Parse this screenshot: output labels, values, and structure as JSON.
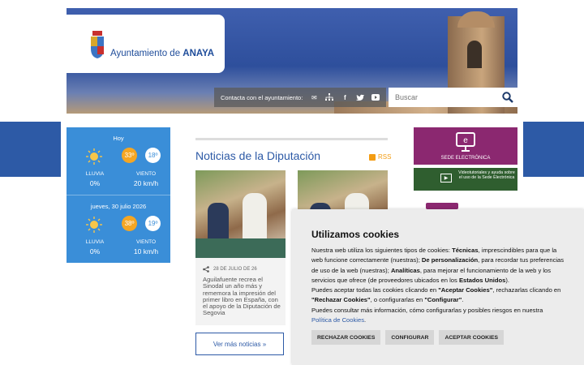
{
  "header": {
    "logo_text_prefix": "Ayuntamiento de ",
    "logo_text_name": "ANAYA",
    "contact_label": "Contacta con el ayuntamiento:",
    "search_placeholder": "Buscar"
  },
  "weather": {
    "days": [
      {
        "label": "Hoy",
        "max": "33º",
        "min": "18º",
        "rain_label": "LLUVIA",
        "rain": "0%",
        "wind_label": "VIENTO",
        "wind": "20 km/h"
      },
      {
        "label": "jueves, 30 julio 2026",
        "max": "38º",
        "min": "19º",
        "rain_label": "LLUVIA",
        "rain": "0%",
        "wind_label": "VIENTO",
        "wind": "10 km/h"
      }
    ]
  },
  "news": {
    "title": "Noticias de la Diputación",
    "rss": "RSS",
    "items": [
      {
        "date": "28 DE JULIO DE 26",
        "text": "Aguilafuente recrea el Sinodal un año más y rememora la impresión del primer libro en España, con el apoyo de la Diputación de Segovia"
      }
    ],
    "more": "Ver más noticias  »"
  },
  "sidebar": {
    "sede": "SEDE ELECTRÓNICA",
    "video": "Videotutoriales y ayuda sobre el uso de la Sede Electrónica"
  },
  "cookies": {
    "title": "Utilizamos cookies",
    "p1_a": "Nuestra web utiliza los siguientes tipos de cookies: ",
    "p1_b": "Técnicas",
    "p1_c": ", imprescindibles para que la web funcione correctamente (nuestras); ",
    "p1_d": "De personalización",
    "p1_e": ", para recordar tus preferencias de uso de la web (nuestras); ",
    "p1_f": "Analíticas",
    "p1_g": ", para mejorar el funcionamiento de la web y los servicios que ofrece (de proveedores ubicados en los ",
    "p1_h": "Estados Unidos",
    "p1_i": ").",
    "p2_a": "Puedes aceptar todas las cookies clicando en ",
    "p2_b": "\"Aceptar Cookies\"",
    "p2_c": ", rechazarlas clicando en ",
    "p2_d": "\"Rechazar Cookies\"",
    "p2_e": ", o configurarlas en ",
    "p2_f": "\"Configurar\"",
    "p2_g": ".",
    "p3": "Puedes consultar más información, cómo configurarlas y posibles riesgos en nuestra ",
    "policy_link": "Política de Cookies",
    "period": ".",
    "reject": "RECHAZAR COOKIES",
    "configure": "CONFIGURAR",
    "accept": "ACEPTAR COOKIES"
  },
  "colors": {
    "primary_blue": "#2d5aa6",
    "weather_blue": "#3a8ed8",
    "sede_purple": "#8b2870",
    "video_green": "#2f5e2f",
    "sun_orange": "#f5a623"
  }
}
